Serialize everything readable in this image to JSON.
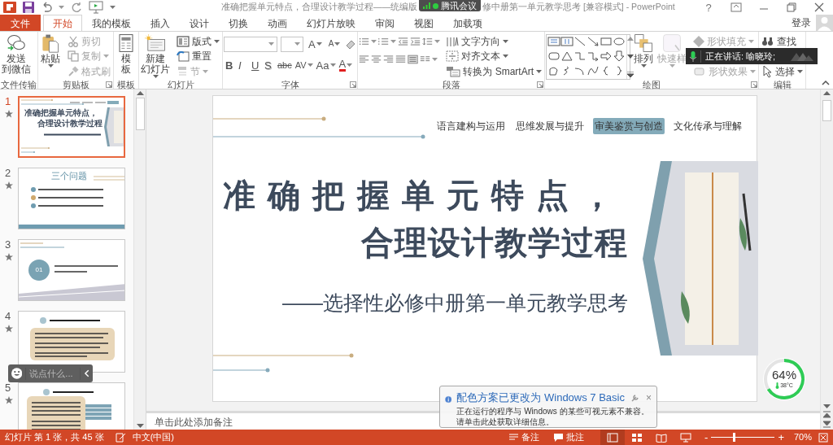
{
  "title_bar": {
    "title_start": "准确把握单元特点，合理设计教学过程——统编版",
    "title_end": "修中册第一单元教学思考 [兼容模式] - PowerPoint",
    "help": "?"
  },
  "meeting_badge": {
    "label": "腾讯会议"
  },
  "tabs": [
    {
      "label": "文件",
      "kind": "file",
      "selected": false
    },
    {
      "label": "开始",
      "kind": "tab",
      "selected": true
    },
    {
      "label": "我的模板",
      "kind": "tab",
      "selected": false
    },
    {
      "label": "插入",
      "kind": "tab",
      "selected": false
    },
    {
      "label": "设计",
      "kind": "tab",
      "selected": false
    },
    {
      "label": "切换",
      "kind": "tab",
      "selected": false
    },
    {
      "label": "动画",
      "kind": "tab",
      "selected": false
    },
    {
      "label": "幻灯片放映",
      "kind": "tab",
      "selected": false
    },
    {
      "label": "审阅",
      "kind": "tab",
      "selected": false
    },
    {
      "label": "视图",
      "kind": "tab",
      "selected": false
    },
    {
      "label": "加载项",
      "kind": "tab",
      "selected": false
    }
  ],
  "sign_in": "登录",
  "ribbon_groups": [
    {
      "label": "文件传输",
      "kind": "buttons",
      "launcher": false,
      "items": [
        {
          "label_lines": [
            "发送",
            "到微信"
          ],
          "kind": "large",
          "disabled": false,
          "menu": false
        }
      ]
    },
    {
      "label": "剪贴板",
      "kind": "buttons",
      "launcher": true,
      "items": [
        {
          "label": "粘贴",
          "kind": "large",
          "disabled": false,
          "menu": true
        },
        {
          "label": "剪切",
          "kind": "small",
          "disabled": true,
          "menu": false
        },
        {
          "label": "复制",
          "kind": "small",
          "disabled": true,
          "menu": true
        },
        {
          "label": "格式刷",
          "kind": "small",
          "disabled": true,
          "menu": false
        }
      ]
    },
    {
      "label": "模板",
      "kind": "buttons",
      "launcher": false,
      "items": [
        {
          "label_lines": [
            "模",
            "板"
          ],
          "kind": "large",
          "disabled": false,
          "menu": false
        }
      ]
    },
    {
      "label": "幻灯片",
      "kind": "buttons",
      "launcher": false,
      "items": [
        {
          "label_lines": [
            "新建",
            "幻灯片"
          ],
          "kind": "large",
          "disabled": false,
          "menu": true
        },
        {
          "label": "版式",
          "kind": "small",
          "disabled": false,
          "menu": true
        },
        {
          "label": "重置",
          "kind": "small",
          "disabled": false,
          "menu": false
        },
        {
          "label": "节",
          "kind": "small",
          "disabled": true,
          "menu": true
        }
      ]
    },
    {
      "label": "字体",
      "kind": "font",
      "launcher": true,
      "size_buttons": [
        "A",
        "A"
      ],
      "format_buttons": [
        "B",
        "I",
        "U",
        "S",
        "abc",
        "AV",
        "Aa",
        "A"
      ]
    },
    {
      "label": "段落",
      "kind": "paragraph",
      "launcher": true,
      "items": [
        {
          "label": "文字方向",
          "kind": "small",
          "disabled": false,
          "menu": true
        },
        {
          "label": "对齐文本",
          "kind": "small",
          "disabled": false,
          "menu": true
        },
        {
          "label": "转换为 SmartArt",
          "kind": "small",
          "disabled": false,
          "menu": true
        }
      ]
    },
    {
      "label": "绘图",
      "kind": "drawing",
      "launcher": true,
      "items": [
        {
          "label": "排列",
          "kind": "large",
          "disabled": false,
          "menu": true
        },
        {
          "label": "快速样",
          "kind": "large",
          "disabled": true,
          "menu": true
        },
        {
          "label": "形状填充",
          "kind": "small",
          "disabled": true,
          "menu": true
        },
        {
          "label": "形状效果",
          "kind": "small",
          "disabled": true,
          "menu": true
        }
      ]
    },
    {
      "label": "编辑",
      "kind": "buttons",
      "launcher": false,
      "items": [
        {
          "label": "查找",
          "kind": "small",
          "disabled": false,
          "menu": false
        },
        {
          "label": "选择",
          "kind": "small",
          "disabled": false,
          "menu": true
        }
      ]
    }
  ],
  "speaking": {
    "label": "正在讲话: 喻晓玲;"
  },
  "thumbnails": [
    {
      "number": "1",
      "kind": "title",
      "selected": true,
      "title_lines": [
        "准确把握单元特点，",
        "合理设计教学过程"
      ]
    },
    {
      "number": "2",
      "kind": "list",
      "selected": false,
      "heading": "三个问题"
    },
    {
      "number": "3",
      "kind": "section",
      "selected": false,
      "badge": "01"
    },
    {
      "number": "4",
      "kind": "content",
      "selected": false
    },
    {
      "number": "5",
      "kind": "content_side",
      "selected": false
    }
  ],
  "slide": {
    "top_labels": [
      {
        "label": "语言建构与运用",
        "highlighted": false
      },
      {
        "label": "思维发展与提升",
        "highlighted": false
      },
      {
        "label": "审美鉴赏与创造",
        "highlighted": true
      },
      {
        "label": "文化传承与理解",
        "highlighted": false
      }
    ],
    "title_lines": [
      "准确把握单元特点，",
      "合理设计教学过程"
    ],
    "subtitle": "——选择性必修中册第一单元教学思考"
  },
  "notes_placeholder": "单击此处添加备注",
  "chat": {
    "placeholder": "说点什么..."
  },
  "gauge": {
    "reading": "64%",
    "temperature": "38°C"
  },
  "status_bar": {
    "slide_info": "幻灯片 第 1 张，共 45 张",
    "language": "中文(中国)",
    "notes": "备注",
    "comments": "批注",
    "views": [
      {
        "selected": true
      },
      {
        "selected": false
      },
      {
        "selected": false
      },
      {
        "selected": false
      }
    ],
    "zoom_out": "-",
    "zoom_in": "+",
    "zoom": {
      "level": 0.36,
      "reading": "70%"
    }
  },
  "balloon": {
    "title": "配色方案已更改为 Windows 7 Basic",
    "body_lines": [
      "正在运行的程序与 Windows 的某些可视元素不兼容。",
      "请单击此处获取详细信息。"
    ],
    "close": "×"
  }
}
